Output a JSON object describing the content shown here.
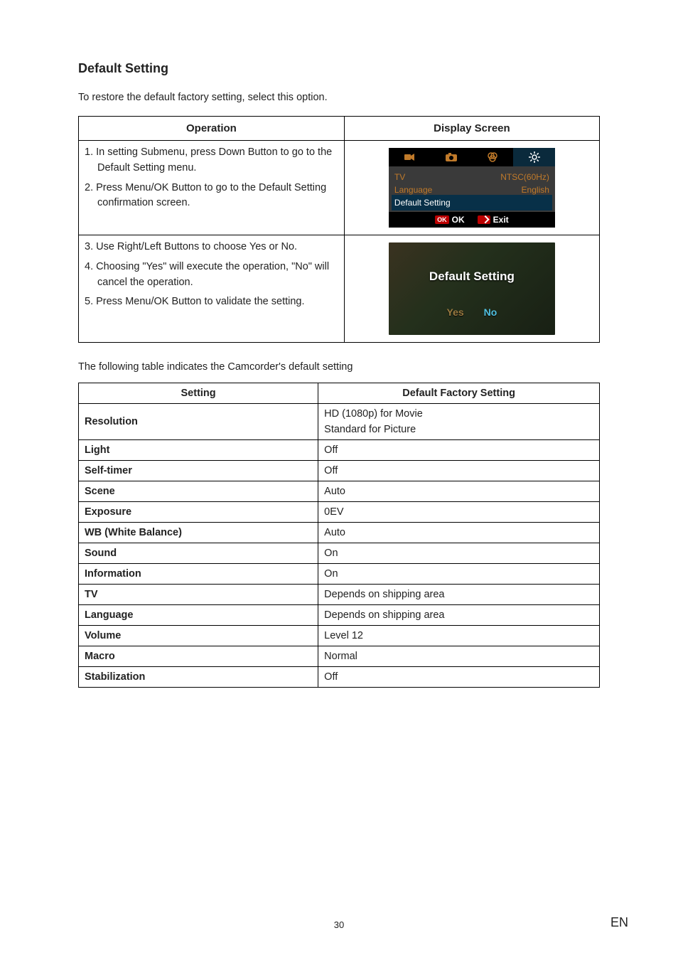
{
  "heading": "Default Setting",
  "intro": "To restore the default factory setting, select this option.",
  "op_table": {
    "head_left": "Operation",
    "head_right": "Display Screen",
    "row1_steps": [
      "1. In setting Submenu, press Down Button to go to the Default Setting menu.",
      "2. Press Menu/OK Button to go to the Default Setting confirmation screen."
    ],
    "row2_steps": [
      "3. Use Right/Left Buttons to choose Yes or No.",
      "4. Choosing \"Yes\" will execute the operation, \"No\" will cancel the operation.",
      "5. Press Menu/OK Button to validate the setting."
    ],
    "mock1": {
      "tv_label": "TV",
      "tv_value": "NTSC(60Hz)",
      "lang_label": "Language",
      "lang_value": "English",
      "default_label": "Default Setting",
      "ok_label": "OK",
      "ok_chip": "OK",
      "exit_label": "Exit"
    },
    "mock2": {
      "title": "Default Setting",
      "yes": "Yes",
      "no": "No"
    }
  },
  "mid_text": "The following table indicates the Camcorder's default setting",
  "def_table": {
    "head_left": "Setting",
    "head_right": "Default Factory Setting",
    "rows": [
      {
        "k": "Resolution",
        "v": "HD (1080p) for Movie",
        "v2": "Standard for Picture"
      },
      {
        "k": "Light",
        "v": "Off"
      },
      {
        "k": "Self-timer",
        "v": "Off"
      },
      {
        "k": "Scene",
        "v": "Auto"
      },
      {
        "k": "Exposure",
        "v": "0EV"
      },
      {
        "k": "WB (White Balance)",
        "v": "Auto"
      },
      {
        "k": "Sound",
        "v": "On"
      },
      {
        "k": "Information",
        "v": "On"
      },
      {
        "k": "TV",
        "v": "Depends on shipping area"
      },
      {
        "k": "Language",
        "v": "Depends on shipping area"
      },
      {
        "k": "Volume",
        "v": "Level 12"
      },
      {
        "k": "Macro",
        "v": "Normal"
      },
      {
        "k": "Stabilization",
        "v": "Off"
      }
    ]
  },
  "page_number": "30",
  "lang_code": "EN"
}
